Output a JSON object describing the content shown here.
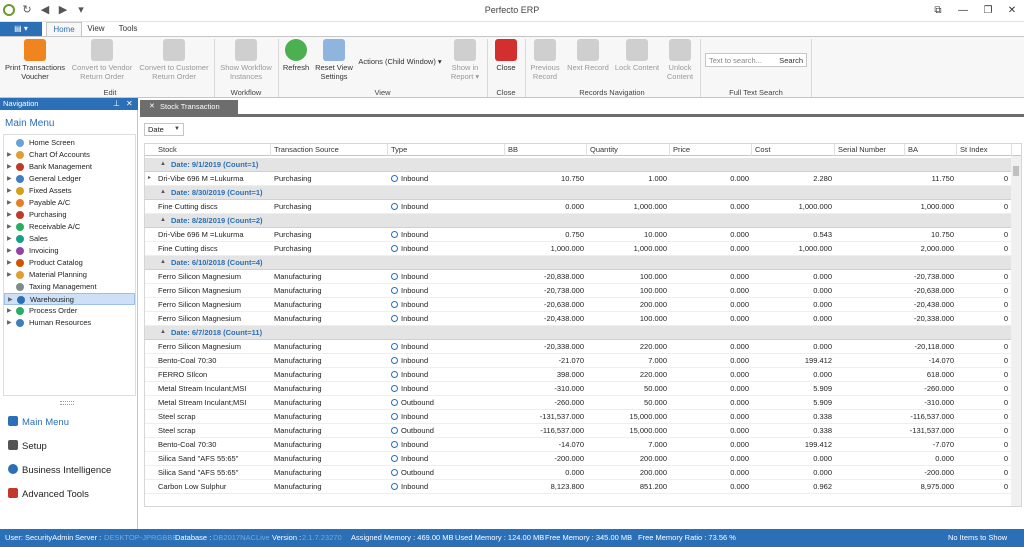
{
  "window": {
    "title": "Perfecto ERP"
  },
  "quick_access": {
    "refresh": "↻",
    "back": "◀",
    "forward": "▶",
    "menu": "▾"
  },
  "window_controls": {
    "pin": "⧉",
    "minimize": "—",
    "restore": "❐",
    "close": "✕"
  },
  "ribbon_tabs": [
    "Home",
    "View",
    "Tools"
  ],
  "file_button": "▤ ▾",
  "ribbon": {
    "groups": [
      "Edit",
      "Workflow",
      "View",
      "Close",
      "Records Navigation",
      "Full Text Search"
    ],
    "buttons": {
      "print_transactions": "Print Transactions Voucher",
      "convert_vendor": "Convert to Vendor Return Order",
      "convert_customer": "Convert to Customer Return Order",
      "show_workflow": "Show Workflow Instances",
      "refresh": "Refresh",
      "reset_view": "Reset View Settings",
      "actions": "Actions (Child Window) ▾",
      "show_in_report": "Show in Report ▾",
      "close": "Close",
      "previous_record": "Previous Record",
      "next_record": "Next Record",
      "lock_content": "Lock Content",
      "unlock_content": "Unlock Content"
    },
    "search": {
      "placeholder": "Text to search...",
      "button": "Search"
    }
  },
  "navigation": {
    "header": "Navigation",
    "pin": "⊥",
    "close": "✕",
    "title": "Main Menu",
    "tree": [
      "Home Screen",
      "Chart Of Accounts",
      "Bank Management",
      "General Ledger",
      "Fixed Assets",
      "Payable A/C",
      "Purchasing",
      "Receivable A/C",
      "Sales",
      "Invoicing",
      "Product Catalog",
      "Material Planning",
      "Taxing Management",
      "Warehousing",
      "Process Order",
      "Human Resources"
    ],
    "bottom": [
      "Main Menu",
      "Setup",
      "Business Intelligence",
      "Advanced Tools"
    ]
  },
  "document_tab": {
    "label": "Stock Transaction",
    "close": "✕"
  },
  "group_by": "Date",
  "grid": {
    "columns": [
      "Stock",
      "Transaction Source",
      "Type",
      "BB",
      "Quantity",
      "Price",
      "Cost",
      "Serial Number",
      "BA",
      "St Index"
    ],
    "rows": [
      {
        "group": "Date: 9/1/2019 (Count=1)"
      },
      {
        "stock": "Dri-Vibe 696 M =Lukurma",
        "source": "Purchasing",
        "type": "Inbound",
        "bb": "10.750",
        "qty": "1.000",
        "price": "0.000",
        "cost": "2.280",
        "ba": "11.750",
        "st": "0"
      },
      {
        "group": "Date: 8/30/2019 (Count=1)"
      },
      {
        "stock": "Fine Cutting discs",
        "source": "Purchasing",
        "type": "Inbound",
        "bb": "0.000",
        "qty": "1,000.000",
        "price": "0.000",
        "cost": "1,000.000",
        "ba": "1,000.000",
        "st": "0"
      },
      {
        "group": "Date: 8/28/2019 (Count=2)"
      },
      {
        "stock": "Dri-Vibe 696 M =Lukurma",
        "source": "Purchasing",
        "type": "Inbound",
        "bb": "0.750",
        "qty": "10.000",
        "price": "0.000",
        "cost": "0.543",
        "ba": "10.750",
        "st": "0"
      },
      {
        "stock": "Fine Cutting discs",
        "source": "Purchasing",
        "type": "Inbound",
        "bb": "1,000.000",
        "qty": "1,000.000",
        "price": "0.000",
        "cost": "1,000.000",
        "ba": "2,000.000",
        "st": "0"
      },
      {
        "group": "Date: 6/10/2018 (Count=4)"
      },
      {
        "stock": "Ferro Silicon Magnesium",
        "source": "Manufacturing",
        "type": "Inbound",
        "bb": "-20,838.000",
        "qty": "100.000",
        "price": "0.000",
        "cost": "0.000",
        "ba": "-20,738.000",
        "st": "0"
      },
      {
        "stock": "Ferro Silicon Magnesium",
        "source": "Manufacturing",
        "type": "Inbound",
        "bb": "-20,738.000",
        "qty": "100.000",
        "price": "0.000",
        "cost": "0.000",
        "ba": "-20,638.000",
        "st": "0"
      },
      {
        "stock": "Ferro Silicon Magnesium",
        "source": "Manufacturing",
        "type": "Inbound",
        "bb": "-20,638.000",
        "qty": "200.000",
        "price": "0.000",
        "cost": "0.000",
        "ba": "-20,438.000",
        "st": "0"
      },
      {
        "stock": "Ferro Silicon Magnesium",
        "source": "Manufacturing",
        "type": "Inbound",
        "bb": "-20,438.000",
        "qty": "100.000",
        "price": "0.000",
        "cost": "0.000",
        "ba": "-20,338.000",
        "st": "0"
      },
      {
        "group": "Date: 6/7/2018 (Count=11)"
      },
      {
        "stock": "Ferro Silicon Magnesium",
        "source": "Manufacturing",
        "type": "Inbound",
        "bb": "-20,338.000",
        "qty": "220.000",
        "price": "0.000",
        "cost": "0.000",
        "ba": "-20,118.000",
        "st": "0"
      },
      {
        "stock": "Bento-Coal 70:30",
        "source": "Manufacturing",
        "type": "Inbound",
        "bb": "-21.070",
        "qty": "7.000",
        "price": "0.000",
        "cost": "199.412",
        "ba": "-14.070",
        "st": "0"
      },
      {
        "stock": "FERRO SIlcon",
        "source": "Manufacturing",
        "type": "Inbound",
        "bb": "398.000",
        "qty": "220.000",
        "price": "0.000",
        "cost": "0.000",
        "ba": "618.000",
        "st": "0"
      },
      {
        "stock": "Metal Stream Inculant;MSI",
        "source": "Manufacturing",
        "type": "Inbound",
        "bb": "-310.000",
        "qty": "50.000",
        "price": "0.000",
        "cost": "5.909",
        "ba": "-260.000",
        "st": "0"
      },
      {
        "stock": "Metal Stream Inculant;MSI",
        "source": "Manufacturing",
        "type": "Outbound",
        "bb": "-260.000",
        "qty": "50.000",
        "price": "0.000",
        "cost": "5.909",
        "ba": "-310.000",
        "st": "0"
      },
      {
        "stock": "Steel scrap",
        "source": "Manufacturing",
        "type": "Inbound",
        "bb": "-131,537.000",
        "qty": "15,000.000",
        "price": "0.000",
        "cost": "0.338",
        "ba": "-116,537.000",
        "st": "0"
      },
      {
        "stock": "Steel scrap",
        "source": "Manufacturing",
        "type": "Outbound",
        "bb": "-116,537.000",
        "qty": "15,000.000",
        "price": "0.000",
        "cost": "0.338",
        "ba": "-131,537.000",
        "st": "0"
      },
      {
        "stock": "Bento-Coal 70:30",
        "source": "Manufacturing",
        "type": "Inbound",
        "bb": "-14.070",
        "qty": "7.000",
        "price": "0.000",
        "cost": "199.412",
        "ba": "-7.070",
        "st": "0"
      },
      {
        "stock": "Silica Sand \"AFS 55:65\"",
        "source": "Manufacturing",
        "type": "Inbound",
        "bb": "-200.000",
        "qty": "200.000",
        "price": "0.000",
        "cost": "0.000",
        "ba": "0.000",
        "st": "0"
      },
      {
        "stock": "Silica Sand \"AFS 55:65\"",
        "source": "Manufacturing",
        "type": "Outbound",
        "bb": "0.000",
        "qty": "200.000",
        "price": "0.000",
        "cost": "0.000",
        "ba": "-200.000",
        "st": "0"
      },
      {
        "stock": "Carbon Low Sulphur",
        "source": "Manufacturing",
        "type": "Inbound",
        "bb": "8,123.800",
        "qty": "851.200",
        "price": "0.000",
        "cost": "0.962",
        "ba": "8,975.000",
        "st": "0"
      }
    ]
  },
  "status_bar": {
    "user": "User: SecurityAdmin",
    "server_label": "Server :",
    "server_value": "DESKTOP-JPRGBBB",
    "database_label": "Database :",
    "database_value": "DB2017NACLive",
    "version_label": "Version :",
    "version_value": "2.1.7.23270",
    "assigned_memory": "Assigned Memory : 469.00 MB",
    "used_memory": "Used Memory : 124.00 MB",
    "free_memory": "Free Memory : 345.00 MB",
    "free_memory_ratio": "Free Memory Ratio : 73.56 %",
    "items": "No Items to Show"
  },
  "colors": {
    "accent": "#2b6fb6",
    "close_red": "#d32f2f",
    "refresh_green": "#4caf50",
    "print_orange": "#f0841e"
  }
}
